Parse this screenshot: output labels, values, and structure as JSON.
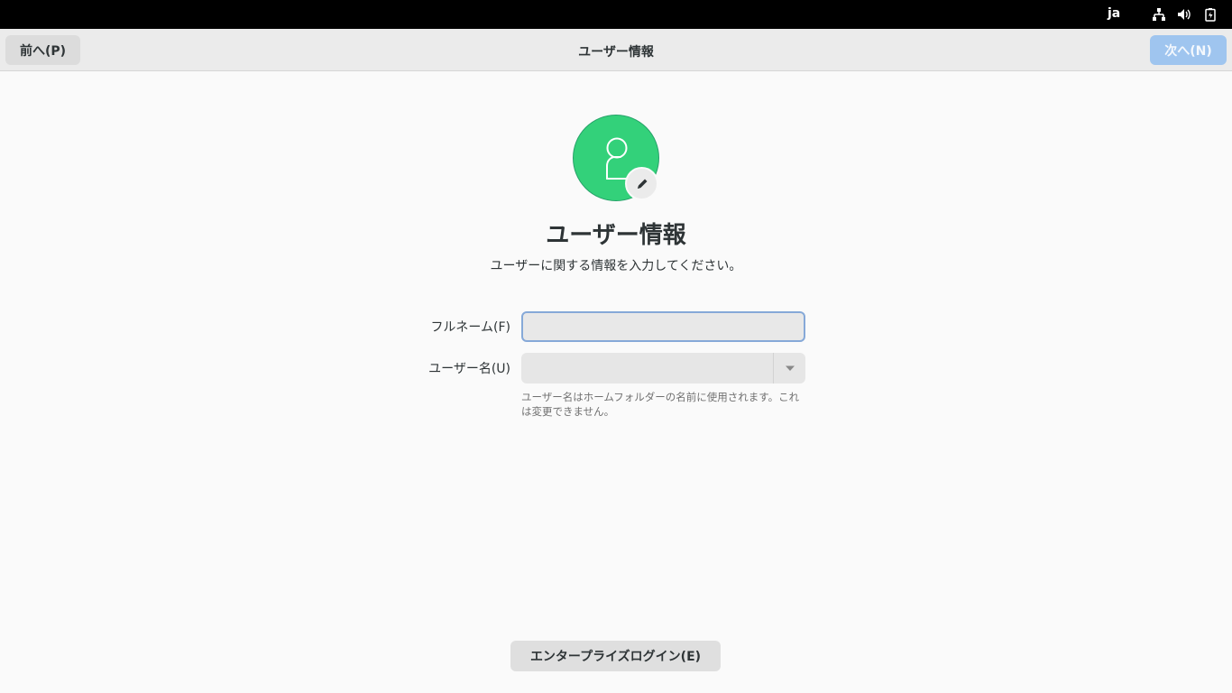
{
  "topbar": {
    "language": "ja",
    "icons": [
      "network-wired-icon",
      "volume-icon",
      "battery-icon"
    ]
  },
  "header": {
    "prev_label": "前へ(P)",
    "title": "ユーザー情報",
    "next_label": "次へ(N)"
  },
  "main": {
    "avatar_icon": "user-avatar-icon",
    "edit_icon": "pencil-icon",
    "title": "ユーザー情報",
    "subtitle": "ユーザーに関する情報を入力してください。",
    "fullname_label": "フルネーム(F)",
    "fullname_value": "",
    "username_label": "ユーザー名(U)",
    "username_value": "",
    "username_hint": "ユーザー名はホームフォルダーの名前に使用されます。これは変更できません。"
  },
  "footer": {
    "enterprise_login_label": "エンタープライズログイン(E)"
  },
  "colors": {
    "avatar_bg": "#33d17a",
    "next_button_bg": "#9fc5ef",
    "focus_border": "#86a9d8"
  }
}
